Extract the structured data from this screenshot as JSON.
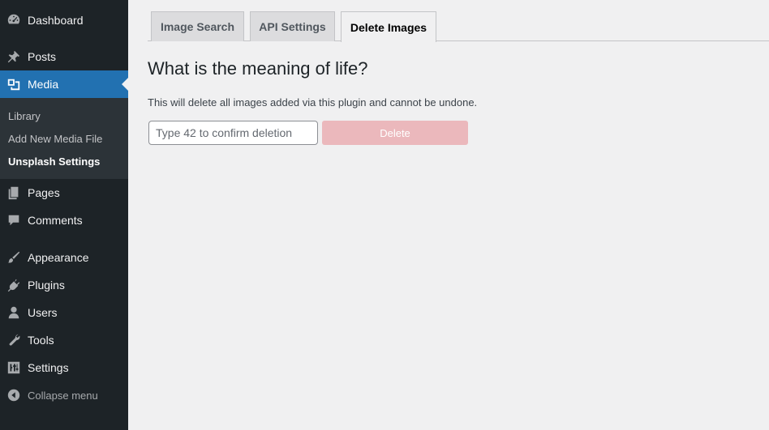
{
  "sidebar": {
    "items": [
      {
        "label": "Dashboard",
        "icon": "dashboard-icon"
      },
      {
        "label": "Posts",
        "icon": "pin-icon"
      },
      {
        "label": "Media",
        "icon": "media-icon"
      },
      {
        "label": "Pages",
        "icon": "pages-icon"
      },
      {
        "label": "Comments",
        "icon": "comment-icon"
      },
      {
        "label": "Appearance",
        "icon": "brush-icon"
      },
      {
        "label": "Plugins",
        "icon": "plug-icon"
      },
      {
        "label": "Users",
        "icon": "user-icon"
      },
      {
        "label": "Tools",
        "icon": "wrench-icon"
      },
      {
        "label": "Settings",
        "icon": "sliders-icon"
      }
    ],
    "submenu": [
      {
        "label": "Library"
      },
      {
        "label": "Add New Media File"
      },
      {
        "label": "Unsplash Settings"
      }
    ],
    "collapse_label": "Collapse menu",
    "active_item": "Media",
    "current_submenu": "Unsplash Settings"
  },
  "tabs": [
    {
      "label": "Image Search"
    },
    {
      "label": "API Settings"
    },
    {
      "label": "Delete Images"
    }
  ],
  "active_tab": "Delete Images",
  "main": {
    "heading": "What is the meaning of life?",
    "description": "This will delete all images added via this plugin and cannot be undone.",
    "confirm_input": {
      "value": "",
      "placeholder": "Type 42 to confirm deletion"
    },
    "delete_label": "Delete"
  },
  "colors": {
    "sidebar_bg": "#1d2327",
    "active_blue": "#2271b1",
    "delete_disabled": "#ebb8bc"
  }
}
